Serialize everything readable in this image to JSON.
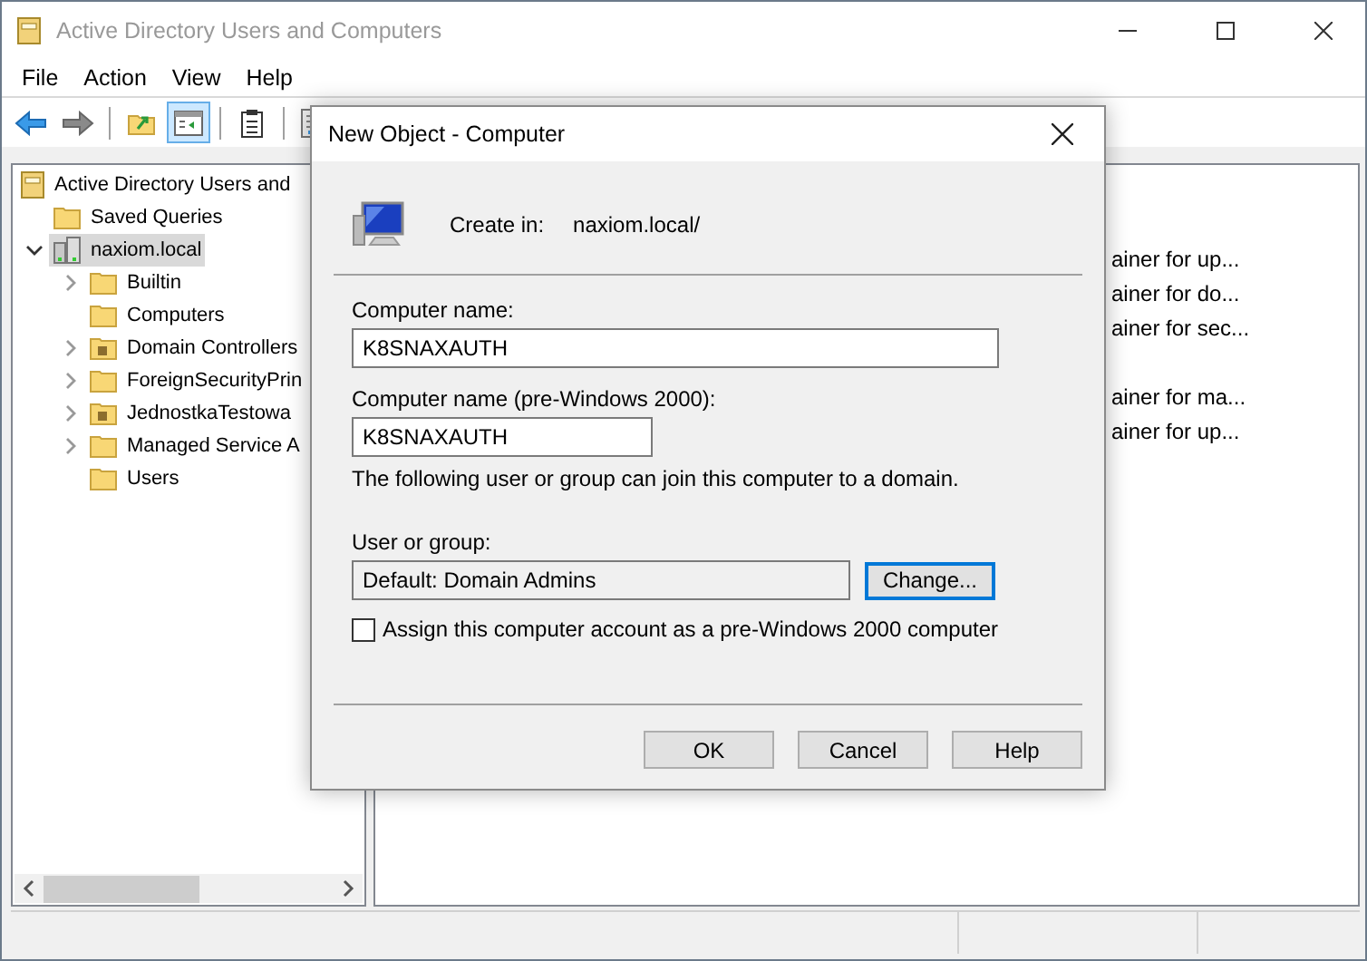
{
  "window": {
    "title": "Active Directory Users and Computers"
  },
  "menu": [
    "File",
    "Action",
    "View",
    "Help"
  ],
  "toolbar": [
    {
      "kind": "back",
      "pressed": false
    },
    {
      "kind": "forward",
      "pressed": false
    },
    {
      "kind": "separator"
    },
    {
      "kind": "up",
      "pressed": false
    },
    {
      "kind": "tree",
      "pressed": true
    },
    {
      "kind": "separator"
    },
    {
      "kind": "clipboard",
      "pressed": false
    },
    {
      "kind": "separator"
    },
    {
      "kind": "properties",
      "pressed": false
    }
  ],
  "tree": {
    "label": "Active Directory Users and",
    "kind": "root",
    "selected": false,
    "children": [
      {
        "label": "Saved Queries",
        "kind": "folder",
        "selected": false
      },
      {
        "label": "naxiom.local",
        "kind": "domain",
        "selected": true,
        "expanded": true,
        "children": [
          {
            "label": "Builtin",
            "kind": "folder",
            "selected": false,
            "expandable": true
          },
          {
            "label": "Computers",
            "kind": "folder",
            "selected": false,
            "expandable": false
          },
          {
            "label": "Domain Controllers",
            "kind": "ou",
            "selected": false,
            "expandable": true
          },
          {
            "label": "ForeignSecurityPrin",
            "kind": "folder",
            "selected": false,
            "expandable": true
          },
          {
            "label": "JednostkaTestowa",
            "kind": "ou",
            "selected": false,
            "expandable": true
          },
          {
            "label": "Managed Service A",
            "kind": "folder",
            "selected": false,
            "expandable": true
          },
          {
            "label": "Users",
            "kind": "folder",
            "selected": false,
            "expandable": false
          }
        ]
      }
    ]
  },
  "details": [
    {
      "kind": "text",
      "text": "ainer for up..."
    },
    {
      "kind": "text",
      "text": "ainer for do..."
    },
    {
      "kind": "text",
      "text": "ainer for sec..."
    },
    {
      "kind": "blank"
    },
    {
      "kind": "text",
      "text": "ainer for ma..."
    },
    {
      "kind": "text",
      "text": "ainer for up..."
    }
  ],
  "dialog": {
    "title": "New Object - Computer",
    "create_in_label": "Create in:",
    "create_in_value": "naxiom.local/",
    "computer_name": {
      "label": "Computer name:",
      "value": "K8SNAXAUTH"
    },
    "pre2000_name": {
      "label": "Computer name (pre-Windows 2000):",
      "value": "K8SNAXAUTH"
    },
    "note": "The following user or group can join this computer to a domain.",
    "user_group": {
      "label": "User or group:",
      "value": "Default: Domain Admins",
      "button": "Change..."
    },
    "checkbox": {
      "label": "Assign this computer account as a pre-Windows 2000 computer",
      "checked": false
    },
    "buttons": [
      "OK",
      "Cancel",
      "Help"
    ]
  }
}
